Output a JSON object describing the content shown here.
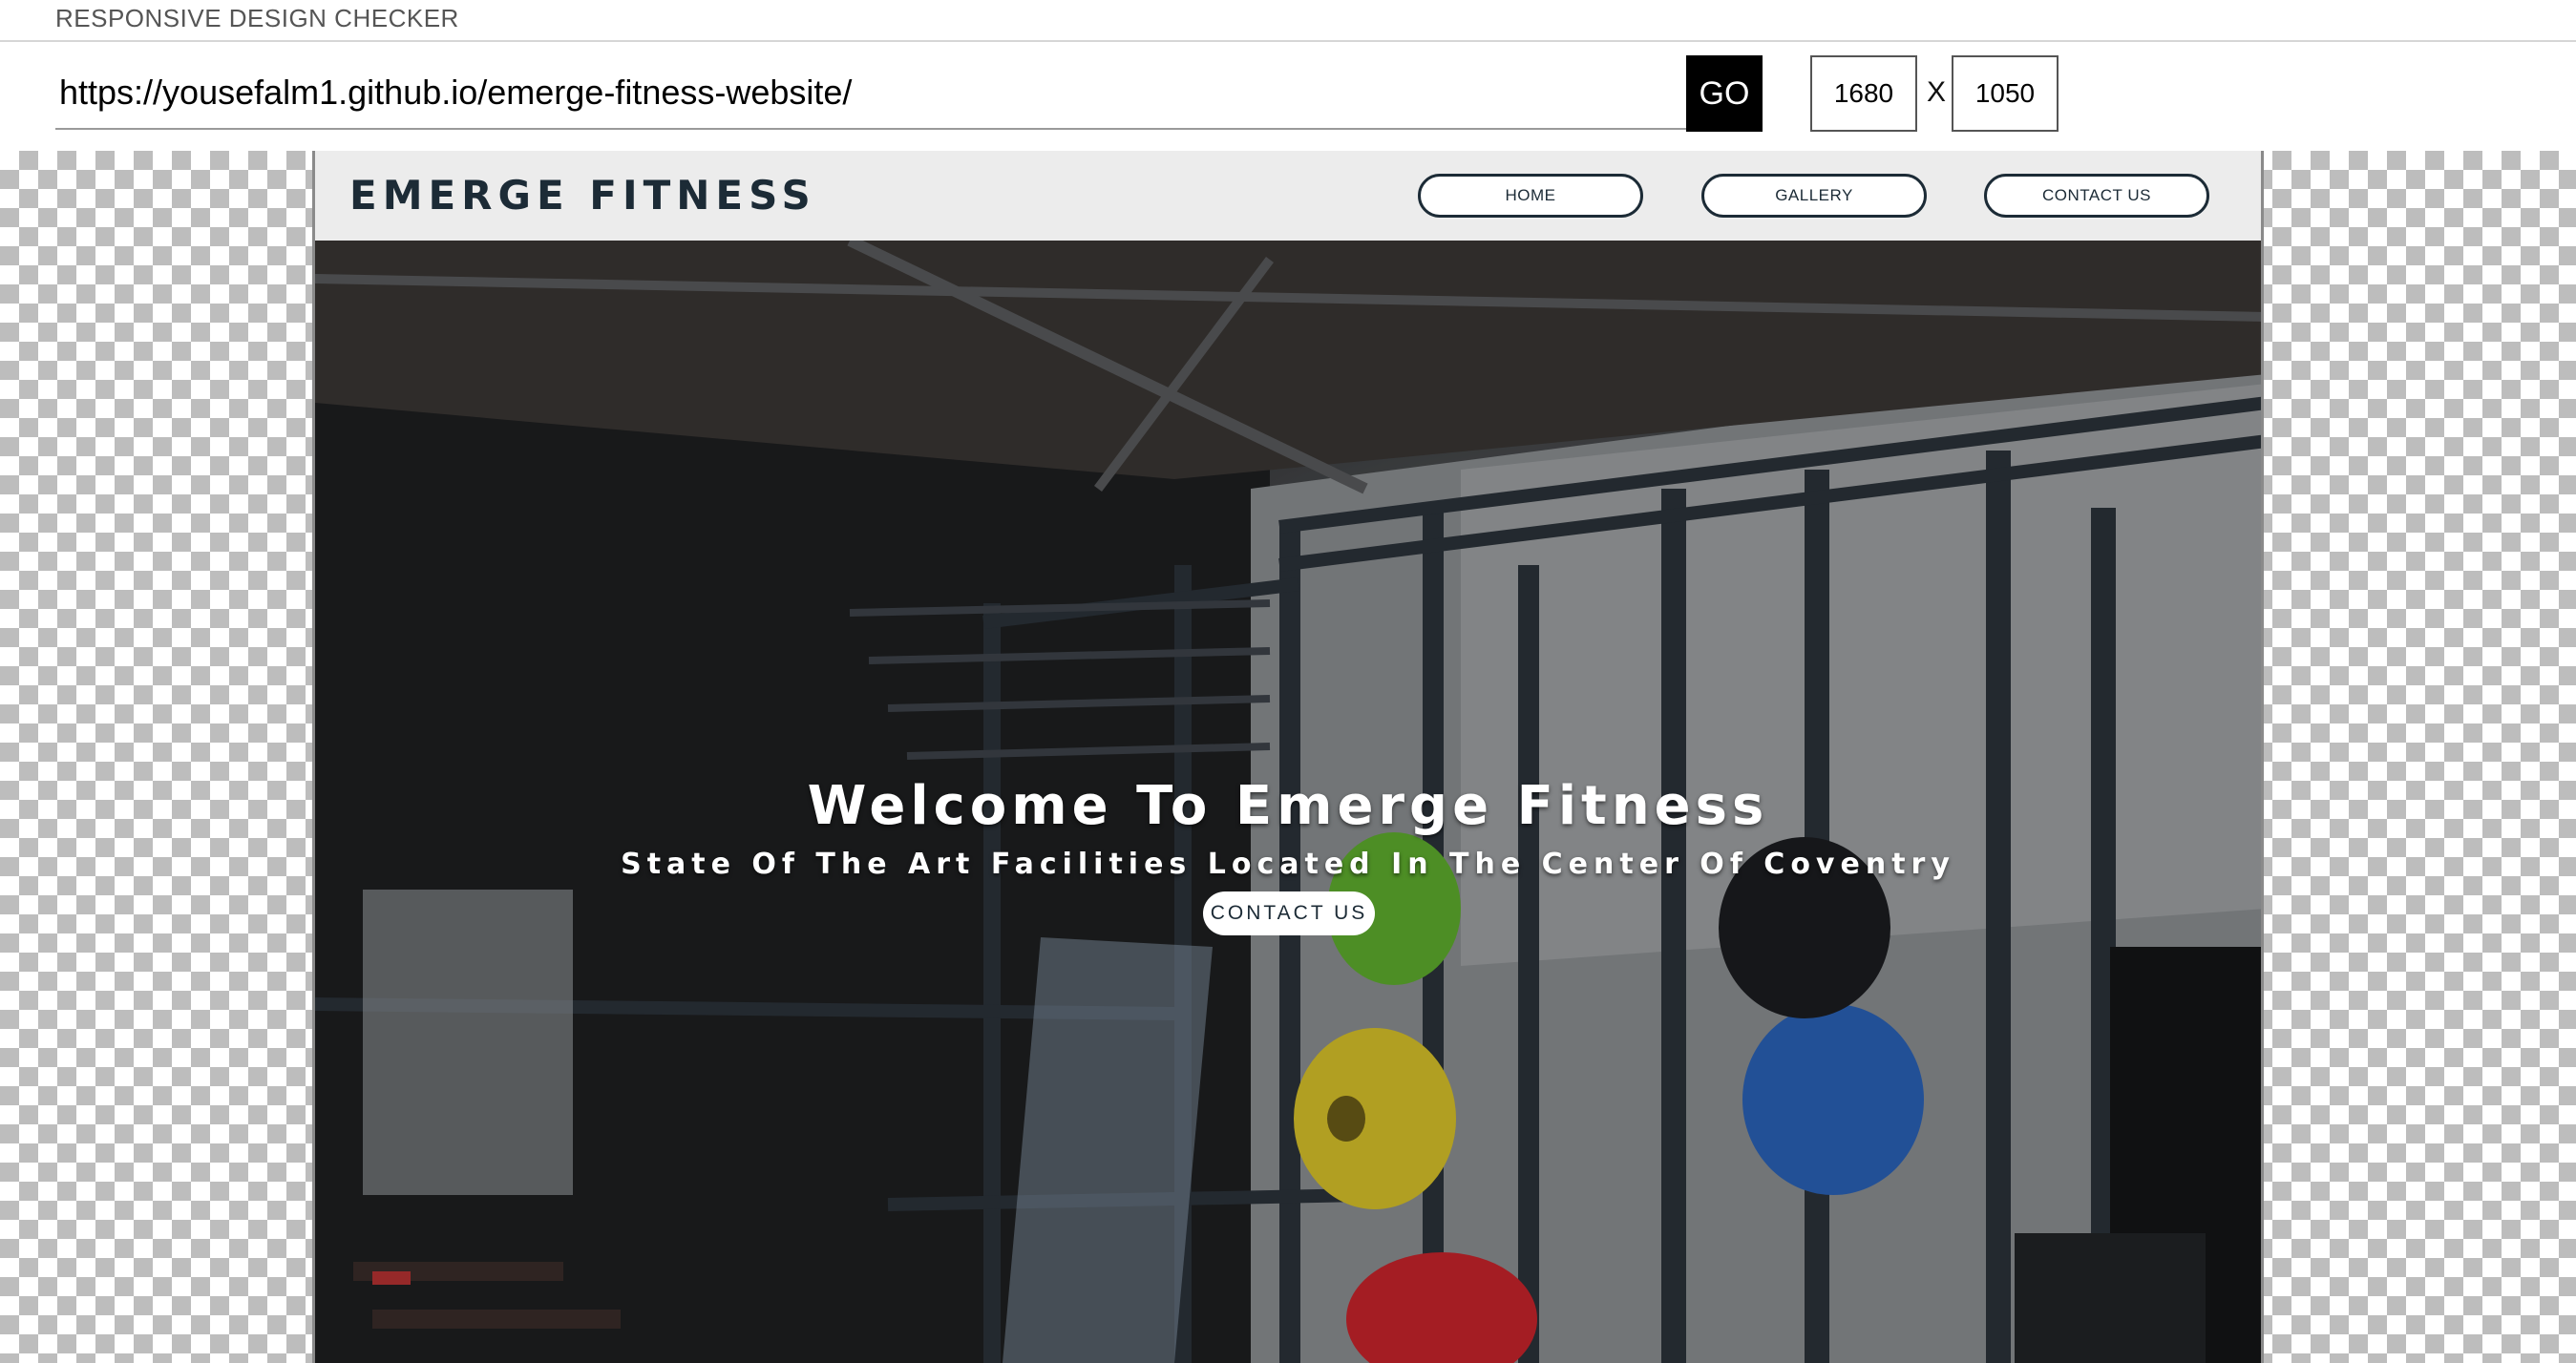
{
  "checker": {
    "title": "RESPONSIVE DESIGN CHECKER",
    "url": "https://yousefalm1.github.io/emerge-fitness-website/",
    "go_label": "GO",
    "width": "1680",
    "height": "1050",
    "x_label": "X"
  },
  "site": {
    "logo": "EMERGE FITNESS",
    "nav": [
      {
        "label": "HOME"
      },
      {
        "label": "GALLERY"
      },
      {
        "label": "CONTACT US"
      }
    ],
    "hero": {
      "title": "Welcome To Emerge Fitness",
      "subtitle": "State Of The Art Facilities Located In The Center Of Coventry",
      "cta_label": "CONTACT US"
    }
  },
  "colors": {
    "header_bg": "#ececec",
    "brand_dark": "#1c2b36",
    "go_bg": "#000000",
    "checker_square": "#bdbdbd",
    "plate_green": "#5fae2e",
    "plate_yellow": "#d8c22a",
    "plate_blue": "#2a62b8",
    "plate_red": "#c8242b"
  }
}
